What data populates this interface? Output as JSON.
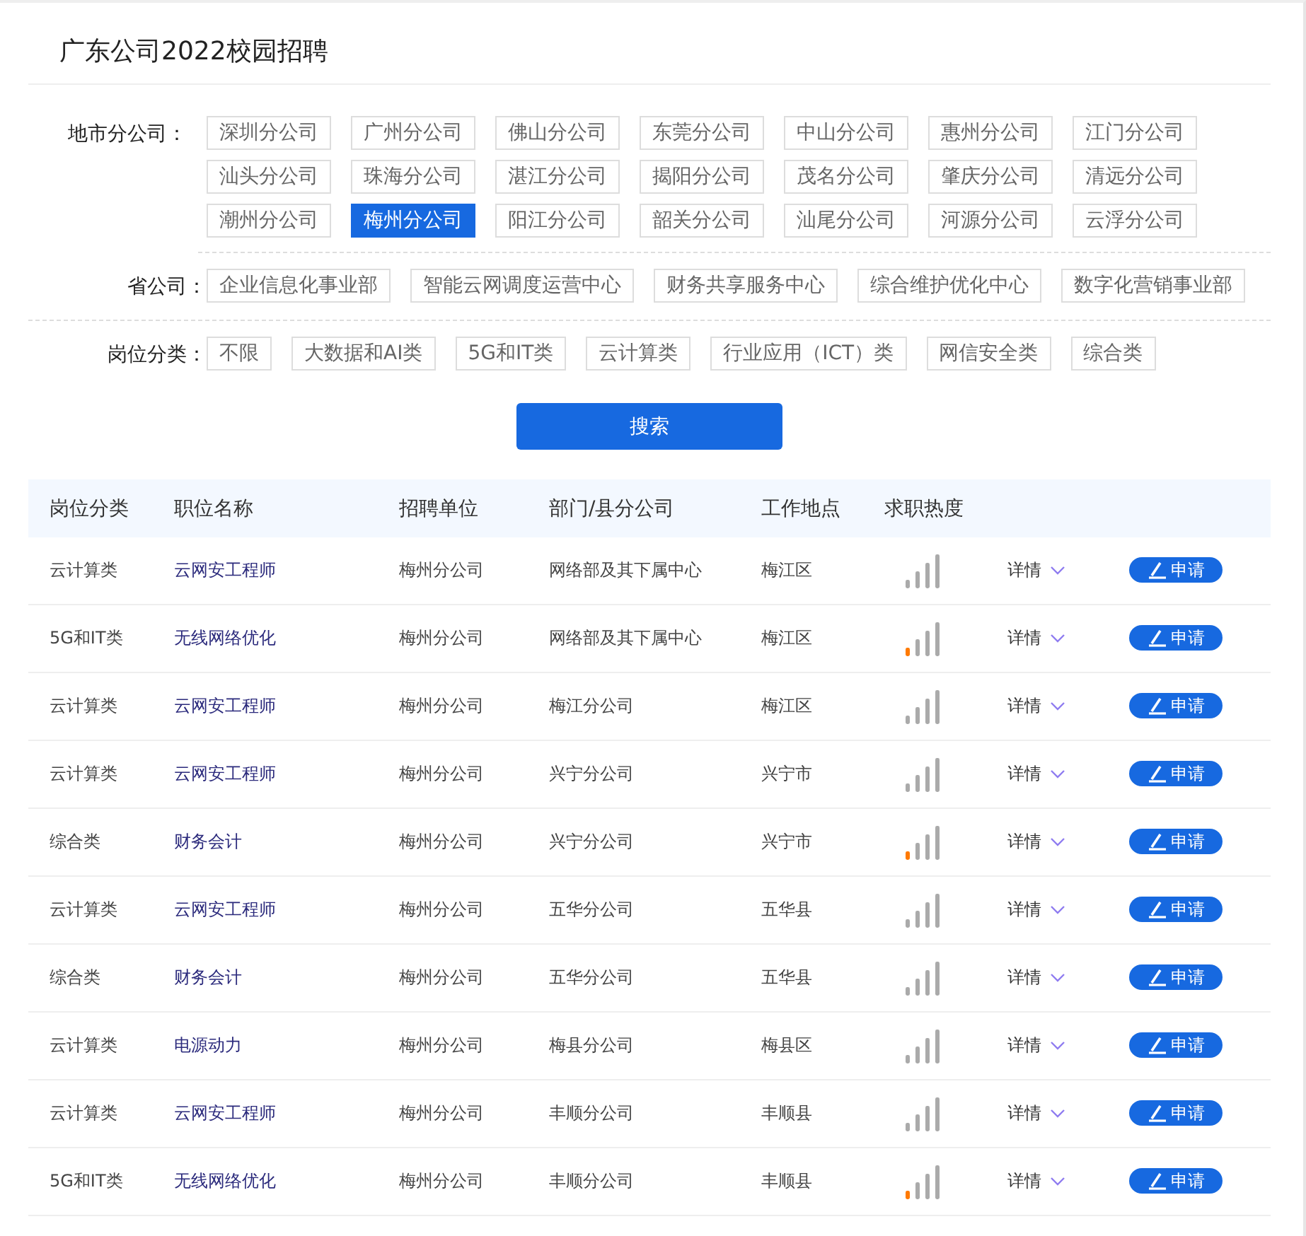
{
  "title": "广东公司2022校园招聘",
  "filters": [
    {
      "label": "地市分公司：",
      "kind": "grid",
      "options": [
        {
          "text": "深圳分公司",
          "selected": false
        },
        {
          "text": "广州分公司",
          "selected": false
        },
        {
          "text": "佛山分公司",
          "selected": false
        },
        {
          "text": "东莞分公司",
          "selected": false
        },
        {
          "text": "中山分公司",
          "selected": false
        },
        {
          "text": "惠州分公司",
          "selected": false
        },
        {
          "text": "江门分公司",
          "selected": false
        },
        {
          "text": "汕头分公司",
          "selected": false
        },
        {
          "text": "珠海分公司",
          "selected": false
        },
        {
          "text": "湛江分公司",
          "selected": false
        },
        {
          "text": "揭阳分公司",
          "selected": false
        },
        {
          "text": "茂名分公司",
          "selected": false
        },
        {
          "text": "肇庆分公司",
          "selected": false
        },
        {
          "text": "清远分公司",
          "selected": false
        },
        {
          "text": "潮州分公司",
          "selected": false
        },
        {
          "text": "梅州分公司",
          "selected": true
        },
        {
          "text": "阳江分公司",
          "selected": false
        },
        {
          "text": "韶关分公司",
          "selected": false
        },
        {
          "text": "汕尾分公司",
          "selected": false
        },
        {
          "text": "河源分公司",
          "selected": false
        },
        {
          "text": "云浮分公司",
          "selected": false
        }
      ]
    },
    {
      "label": "省公司：",
      "kind": "flow",
      "options": [
        {
          "text": "企业信息化事业部",
          "selected": false
        },
        {
          "text": "智能云网调度运营中心",
          "selected": false
        },
        {
          "text": "财务共享服务中心",
          "selected": false
        },
        {
          "text": "综合维护优化中心",
          "selected": false
        },
        {
          "text": "数字化营销事业部",
          "selected": false
        }
      ]
    },
    {
      "label": "岗位分类：",
      "kind": "flow",
      "options": [
        {
          "text": "不限",
          "selected": false
        },
        {
          "text": "大数据和AI类",
          "selected": false
        },
        {
          "text": "5G和IT类",
          "selected": false
        },
        {
          "text": "云计算类",
          "selected": false
        },
        {
          "text": "行业应用（ICT）类",
          "selected": false
        },
        {
          "text": "网信安全类",
          "selected": false
        },
        {
          "text": "综合类",
          "selected": false
        }
      ]
    }
  ],
  "search_button": "搜索",
  "table": {
    "columns": [
      "岗位分类",
      "职位名称",
      "招聘单位",
      "部门/县分公司",
      "工作地点",
      "求职热度"
    ],
    "rows": [
      {
        "category": "云计算类",
        "position": "云网安工程师",
        "unit": "梅州分公司",
        "department": "网络部及其下属中心",
        "location": "梅江区",
        "hot": false,
        "details": "详情",
        "apply": "申请"
      },
      {
        "category": "5G和IT类",
        "position": "无线网络优化",
        "unit": "梅州分公司",
        "department": "网络部及其下属中心",
        "location": "梅江区",
        "hot": true,
        "details": "详情",
        "apply": "申请"
      },
      {
        "category": "云计算类",
        "position": "云网安工程师",
        "unit": "梅州分公司",
        "department": "梅江分公司",
        "location": "梅江区",
        "hot": false,
        "details": "详情",
        "apply": "申请"
      },
      {
        "category": "云计算类",
        "position": "云网安工程师",
        "unit": "梅州分公司",
        "department": "兴宁分公司",
        "location": "兴宁市",
        "hot": false,
        "details": "详情",
        "apply": "申请"
      },
      {
        "category": "综合类",
        "position": "财务会计",
        "unit": "梅州分公司",
        "department": "兴宁分公司",
        "location": "兴宁市",
        "hot": true,
        "details": "详情",
        "apply": "申请"
      },
      {
        "category": "云计算类",
        "position": "云网安工程师",
        "unit": "梅州分公司",
        "department": "五华分公司",
        "location": "五华县",
        "hot": false,
        "details": "详情",
        "apply": "申请"
      },
      {
        "category": "综合类",
        "position": "财务会计",
        "unit": "梅州分公司",
        "department": "五华分公司",
        "location": "五华县",
        "hot": false,
        "details": "详情",
        "apply": "申请"
      },
      {
        "category": "云计算类",
        "position": "电源动力",
        "unit": "梅州分公司",
        "department": "梅县分公司",
        "location": "梅县区",
        "hot": false,
        "details": "详情",
        "apply": "申请"
      },
      {
        "category": "云计算类",
        "position": "云网安工程师",
        "unit": "梅州分公司",
        "department": "丰顺分公司",
        "location": "丰顺县",
        "hot": false,
        "details": "详情",
        "apply": "申请"
      },
      {
        "category": "5G和IT类",
        "position": "无线网络优化",
        "unit": "梅州分公司",
        "department": "丰顺分公司",
        "location": "丰顺县",
        "hot": true,
        "details": "详情",
        "apply": "申请"
      }
    ]
  }
}
